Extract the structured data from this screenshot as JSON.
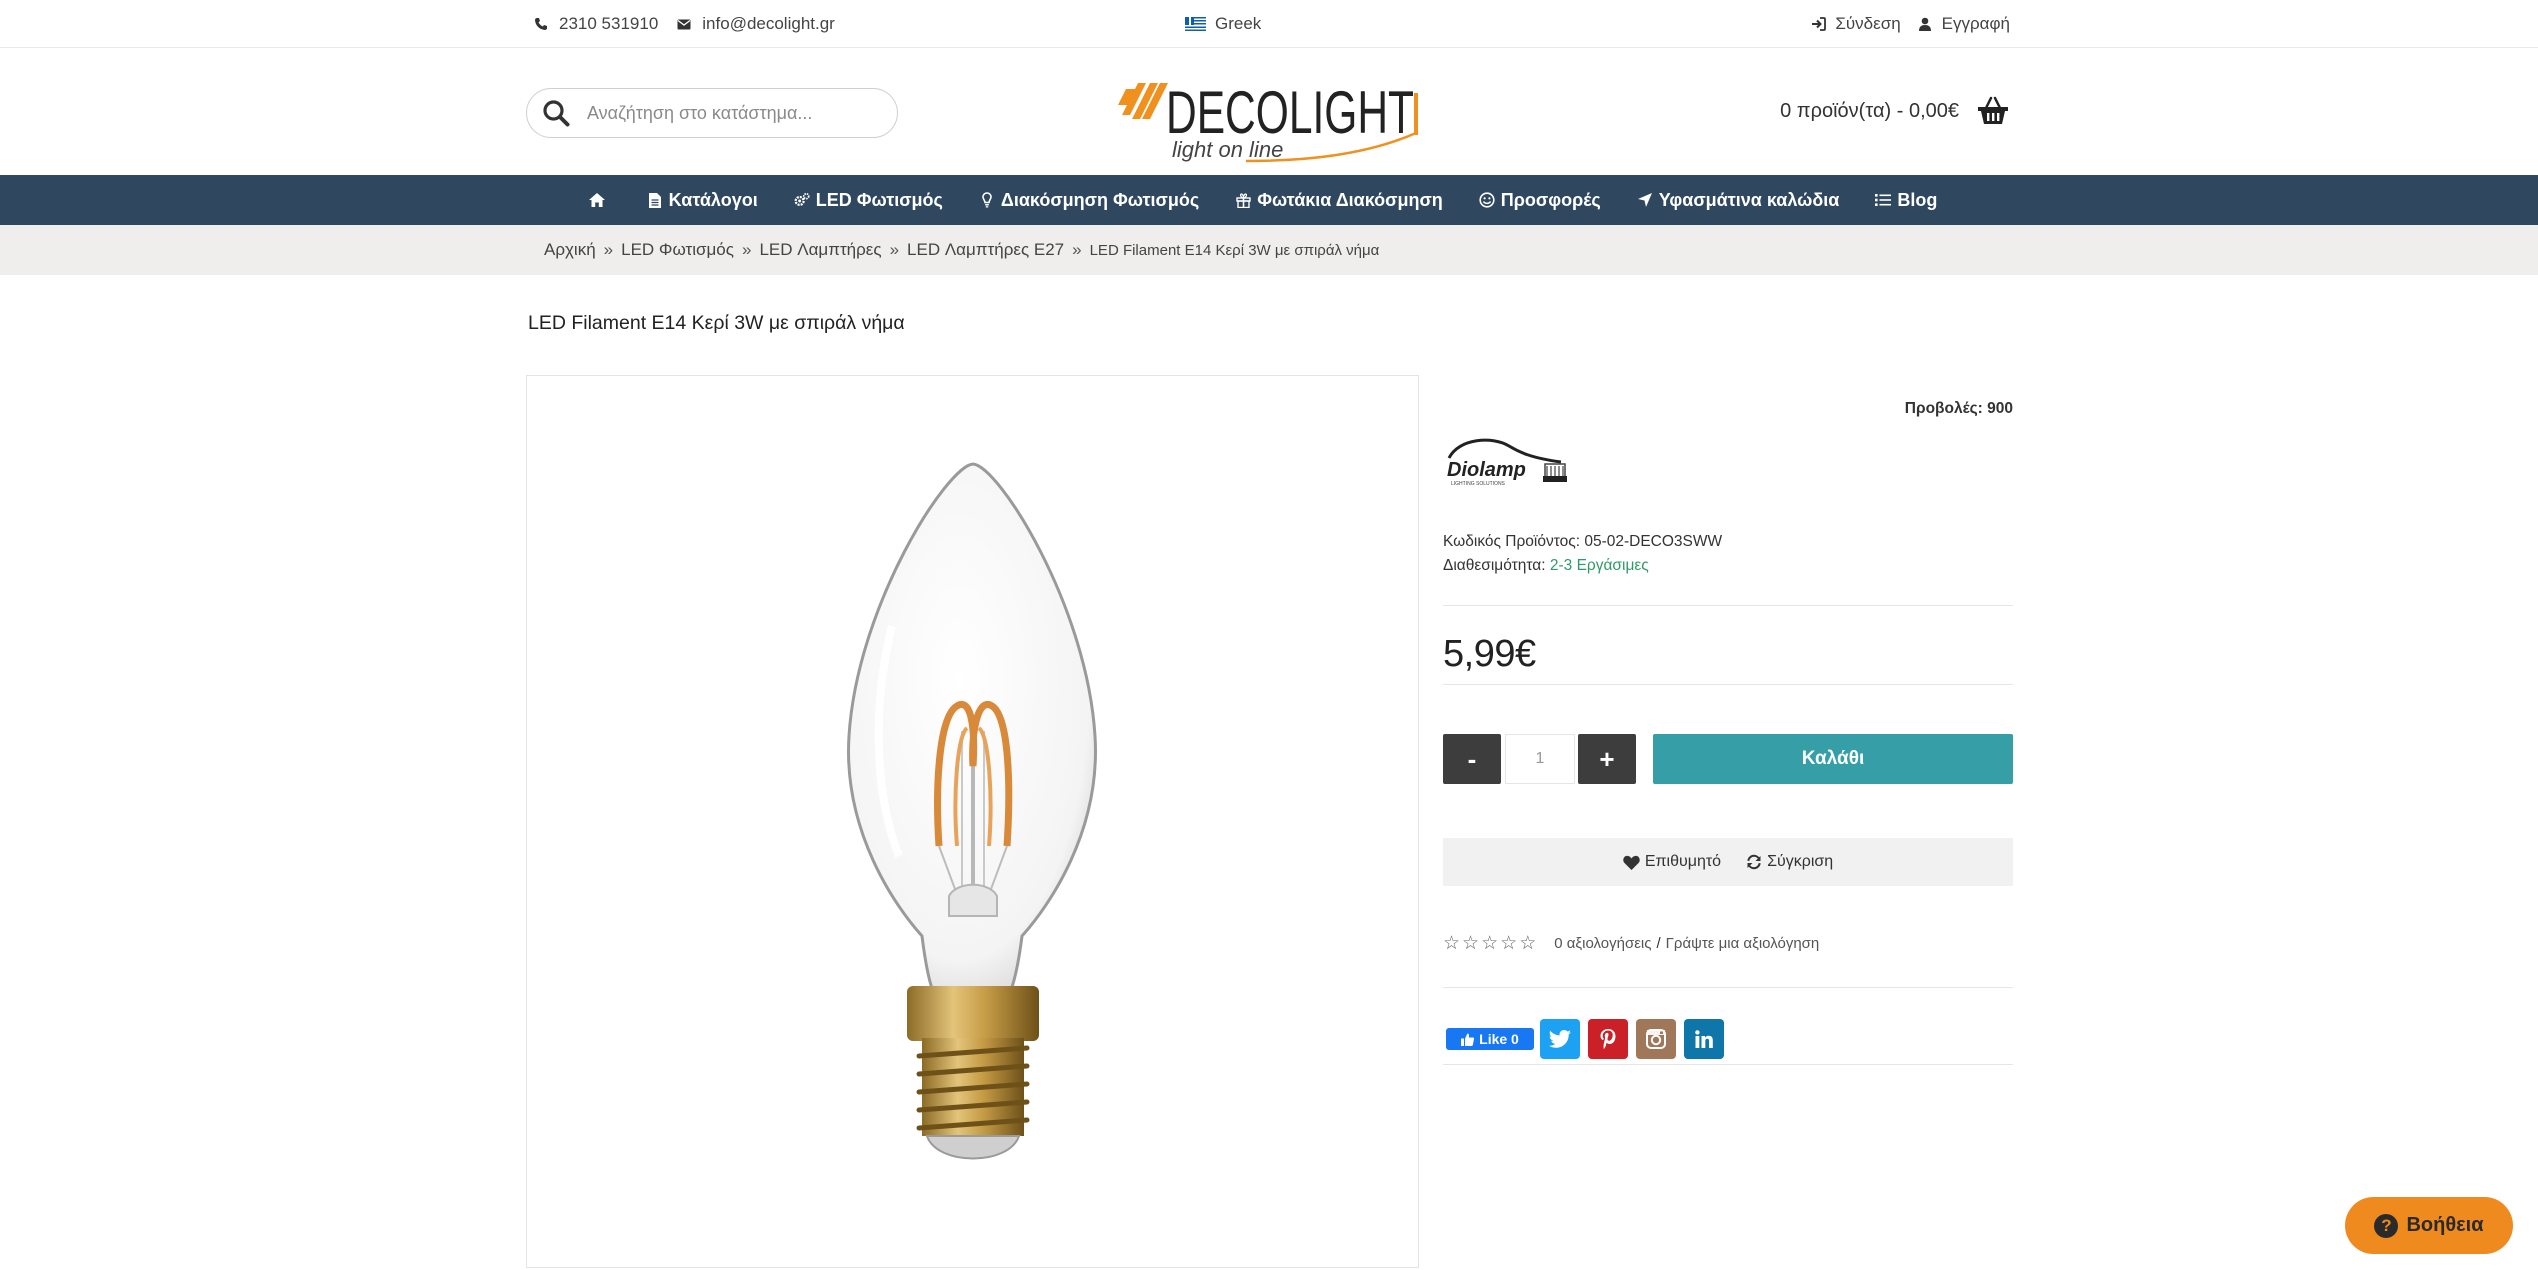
{
  "topbar": {
    "phone": "2310 531910",
    "email": "info@decolight.gr",
    "language": "Greek",
    "login": "Σύνδεση",
    "register": "Εγγραφή"
  },
  "header": {
    "search_placeholder": "Αναζήτηση στο κατάστημα...",
    "logo_text": "DECOLIGHT",
    "logo_tagline": "light on line",
    "cart_summary": "0 προϊόν(τα) - 0,00€"
  },
  "nav": {
    "items": [
      {
        "label": "",
        "icon": "home-icon"
      },
      {
        "label": "Κατάλογοι",
        "icon": "document-icon"
      },
      {
        "label": "LED Φωτισμός",
        "icon": "cogs-icon"
      },
      {
        "label": "Διακόσμηση Φωτισμός",
        "icon": "lightbulb-icon"
      },
      {
        "label": "Φωτάκια Διακόσμηση",
        "icon": "gift-icon"
      },
      {
        "label": "Προσφορές",
        "icon": "smile-icon"
      },
      {
        "label": "Υφασμάτινα καλώδια",
        "icon": "location-arrow-icon"
      },
      {
        "label": "Blog",
        "icon": "list-icon"
      }
    ]
  },
  "breadcrumb": {
    "items": [
      "Αρχική",
      "LED Φωτισμός",
      "LED Λαμπτήρες",
      "LED Λαμπτήρες E27"
    ],
    "current": "LED Filament E14 Κερί 3W με σπιράλ νήμα",
    "separator": "»"
  },
  "product": {
    "title": "LED Filament E14 Κερί 3W με σπιράλ νήμα",
    "views_label": "Προβολές:",
    "views_value": "900",
    "brand_logo_text": "Diolamp",
    "brand_logo_sub": "LIGHTING SOLUTIONS",
    "code_label": "Κωδικός Προϊόντος:",
    "code_value": "05-02-DECO3SWW",
    "availability_label": "Διαθεσιμότητα:",
    "availability_value": "2-3 Εργάσιμες",
    "price": "5,99€",
    "quantity": "1",
    "qty_minus": "-",
    "qty_plus": "+",
    "add_to_cart": "Καλάθι",
    "wishlist": "Επιθυμητό",
    "compare": "Σύγκριση",
    "rating_value": 0,
    "rating_max": 5,
    "reviews_text": "0 αξιολογήσεις",
    "rating_separator": "/",
    "write_review": "Γράψτε μια αξιολόγηση"
  },
  "social": {
    "fb_like": "Like 0",
    "buttons": [
      "twitter-icon",
      "pinterest-icon",
      "instagram-icon",
      "linkedin-icon"
    ]
  },
  "help": {
    "label": "Βοήθεια"
  },
  "colors": {
    "nav_bg": "#2f4860",
    "cart_button": "#369ea7",
    "availability": "#2e9a6a",
    "help_button": "#ef8a1f",
    "logo_orange": "#f0901e"
  }
}
